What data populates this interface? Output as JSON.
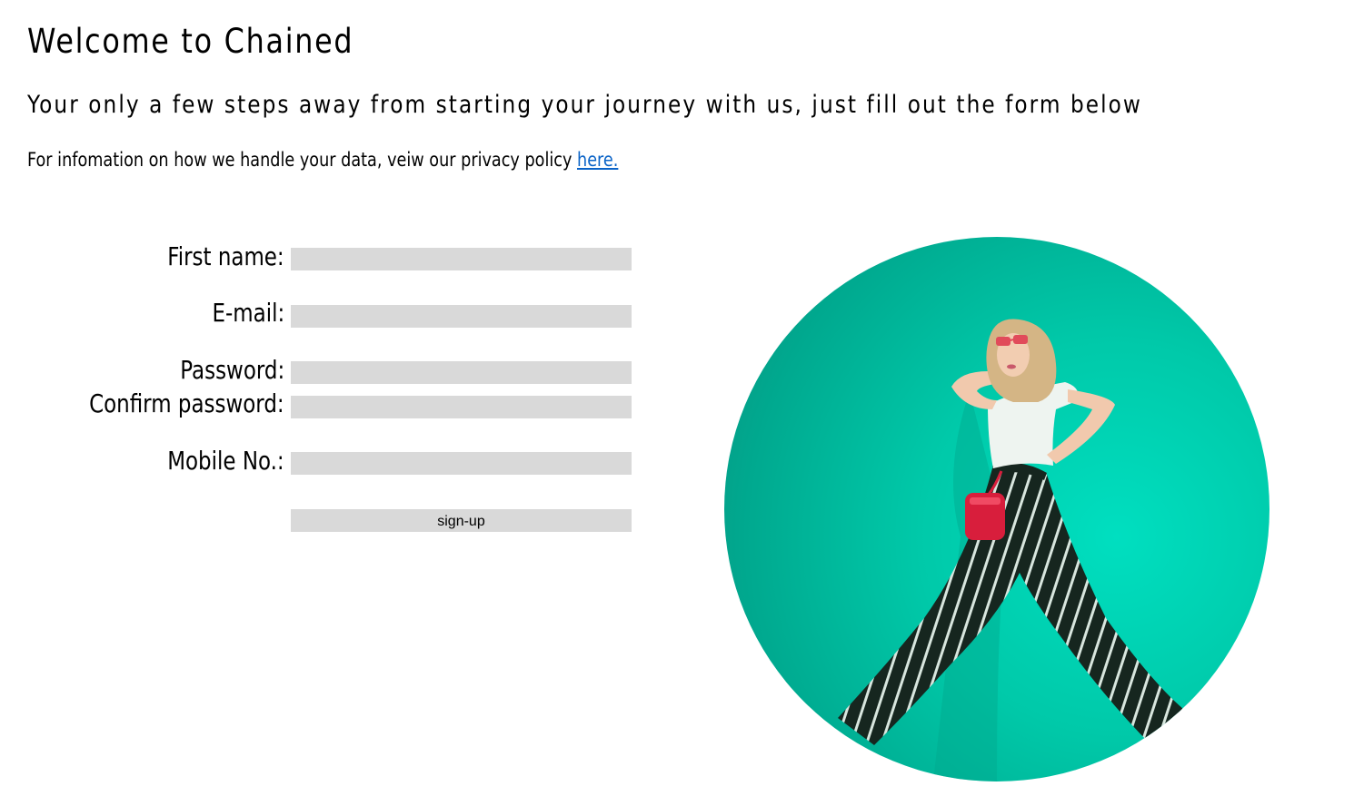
{
  "header": {
    "title": "Welcome to Chained",
    "subtitle": "Your only a few steps away from starting your journey with us, just fill out the form below",
    "privacy_text": "For infomation on how we handle your data, veiw our privacy policy ",
    "privacy_link": "here."
  },
  "form": {
    "first_name_label": "First name:",
    "first_name_value": "",
    "email_label": "E-mail:",
    "email_value": "",
    "password_label": "Password:",
    "password_value": "",
    "confirm_password_label": "Confirm password:",
    "confirm_password_value": "",
    "mobile_label": "Mobile No.:",
    "mobile_value": "",
    "submit_label": "sign-up"
  },
  "colors": {
    "field_background": "#d9d9d9",
    "link": "#0a63c7",
    "photo_background": "#00c9a9"
  }
}
